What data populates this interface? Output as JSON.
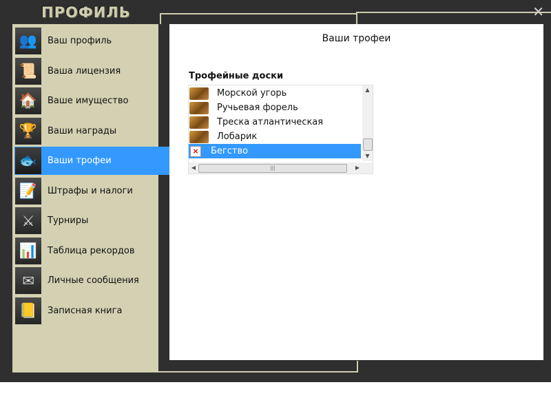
{
  "window": {
    "title": "ПРОФИЛЬ",
    "close_glyph": "✕"
  },
  "sidebar": {
    "items": [
      {
        "label": "Ваш профиль",
        "icon": "users-icon",
        "glyph": "👥",
        "active": false
      },
      {
        "label": "Ваша лицензия",
        "icon": "license-icon",
        "glyph": "📜",
        "active": false
      },
      {
        "label": "Ваше имущество",
        "icon": "house-icon",
        "glyph": "🏠",
        "active": false
      },
      {
        "label": "Ваши награды",
        "icon": "trophy-icon",
        "glyph": "🏆",
        "active": false
      },
      {
        "label": "Ваши трофеи",
        "icon": "fish-icon",
        "glyph": "🐟",
        "active": true
      },
      {
        "label": "Штрафы и налоги",
        "icon": "document-pen-icon",
        "glyph": "📝",
        "active": false
      },
      {
        "label": "Турниры",
        "icon": "tournament-emblem-icon",
        "glyph": "⚔",
        "active": false
      },
      {
        "label": "Таблица рекордов",
        "icon": "bar-chart-icon",
        "glyph": "📊",
        "active": false
      },
      {
        "label": "Личные сообщения",
        "icon": "envelope-icon",
        "glyph": "✉",
        "active": false
      },
      {
        "label": "Записная книга",
        "icon": "notebook-icon",
        "glyph": "📒",
        "active": false
      }
    ]
  },
  "main": {
    "title": "Ваши трофеи",
    "section_label": "Трофейные доски",
    "list": {
      "items": [
        {
          "label": "Морской угорь",
          "thumb": "fish-board-thumbnail",
          "selected": false,
          "broken": false
        },
        {
          "label": "Ручьевая форель",
          "thumb": "fish-board-thumbnail",
          "selected": false,
          "broken": false
        },
        {
          "label": "Треска атлантическая",
          "thumb": "fish-board-thumbnail",
          "selected": false,
          "broken": false
        },
        {
          "label": "Лобарик",
          "thumb": "fish-board-thumbnail",
          "selected": false,
          "broken": false
        },
        {
          "label": "Бегство",
          "thumb": "broken-image-icon",
          "selected": true,
          "broken": true
        }
      ]
    }
  },
  "colors": {
    "accent": "#3399ff",
    "frame": "#2f2f2f",
    "sidebar": "#d3d1b2"
  }
}
